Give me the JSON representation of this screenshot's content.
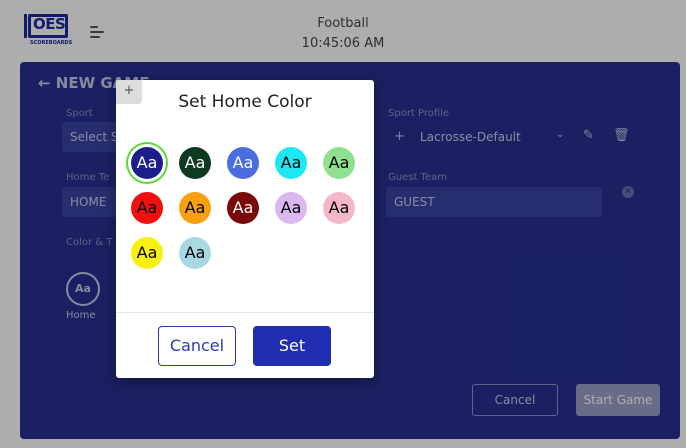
{
  "header": {
    "title": "Football",
    "time": "10:45:06 AM",
    "logo_text": "OES",
    "logo_sub": "SCOREBOARDS"
  },
  "page": {
    "title": "← NEW GAME",
    "sport_label": "Sport",
    "sport_value": "Select S",
    "sport_profile_label": "Sport Profile",
    "sport_profile_value": "Lacrosse-Default",
    "home_team_label": "Home Te",
    "home_team_value": "HOME",
    "guest_team_label": "Guest Team",
    "guest_team_value": "GUEST",
    "color_label": "Color & T",
    "avatar_text": "Aa",
    "home_label": "Home",
    "cancel_label": "Cancel",
    "start_label": "Start Game"
  },
  "modal": {
    "plus": "+",
    "title": "Set Home Color",
    "swatches": [
      {
        "text": "Aa",
        "bg": "#1b1f8a",
        "fg": "#ffffff",
        "selected": true
      },
      {
        "text": "Aa",
        "bg": "#0f3a22",
        "fg": "#ffffff"
      },
      {
        "text": "Aa",
        "bg": "#4a6ee0",
        "fg": "#ffffff"
      },
      {
        "text": "Aa",
        "bg": "#1de8f2",
        "fg": "#000000"
      },
      {
        "text": "Aa",
        "bg": "#8fe08f",
        "fg": "#000000"
      },
      {
        "text": "Aa",
        "bg": "#f20f0f",
        "fg": "#000000"
      },
      {
        "text": "Aa",
        "bg": "#f8a010",
        "fg": "#000000"
      },
      {
        "text": "Aa",
        "bg": "#7a0a0a",
        "fg": "#ffffff"
      },
      {
        "text": "Aa",
        "bg": "#dcb8f0",
        "fg": "#000000"
      },
      {
        "text": "Aa",
        "bg": "#f6b8c8",
        "fg": "#000000"
      },
      {
        "text": "Aa",
        "bg": "#f8f010",
        "fg": "#000000"
      },
      {
        "text": "Aa",
        "bg": "#a8d8e4",
        "fg": "#000000"
      }
    ],
    "cancel_label": "Cancel",
    "set_label": "Set"
  },
  "colors": {
    "panel": "#273090",
    "accent": "#1f2db0",
    "selected_ring": "#5bd83a"
  }
}
